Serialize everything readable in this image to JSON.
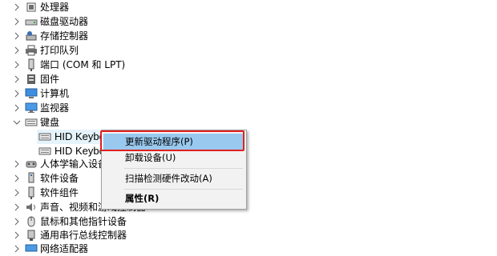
{
  "tree": {
    "items": [
      {
        "label": "处理器",
        "icon": "processor-icon"
      },
      {
        "label": "磁盘驱动器",
        "icon": "disk-drive-icon"
      },
      {
        "label": "存储控制器",
        "icon": "storage-controller-icon"
      },
      {
        "label": "打印队列",
        "icon": "printer-icon"
      },
      {
        "label": "端口 (COM 和 LPT)",
        "icon": "port-icon"
      },
      {
        "label": "固件",
        "icon": "firmware-icon"
      },
      {
        "label": "计算机",
        "icon": "computer-icon"
      },
      {
        "label": "监视器",
        "icon": "monitor-icon"
      },
      {
        "label": "键盘",
        "icon": "keyboard-icon",
        "expanded": true
      },
      {
        "label": "HID Keyboard Device",
        "icon": "keyboard-device-icon",
        "child": true
      },
      {
        "label": "HID Keyboard Device",
        "icon": "keyboard-device-icon",
        "child": true
      },
      {
        "label": "人体学输入设备",
        "icon": "hid-icon"
      },
      {
        "label": "软件设备",
        "icon": "software-device-icon"
      },
      {
        "label": "软件组件",
        "icon": "software-component-icon"
      },
      {
        "label": "声音、视频和游戏控制器",
        "icon": "sound-icon"
      },
      {
        "label": "鼠标和其他指针设备",
        "icon": "mouse-icon"
      },
      {
        "label": "通用串行总线控制器",
        "icon": "usb-icon"
      },
      {
        "label": "网络适配器",
        "icon": "network-adapter-icon"
      }
    ]
  },
  "context_menu": {
    "update_driver": "更新驱动程序(P)",
    "uninstall_device": "卸载设备(U)",
    "scan_hardware": "扫描检测硬件改动(A)",
    "properties": "属性(R)"
  },
  "colors": {
    "highlight": "#99c9ef",
    "annotation_box": "#e02020"
  }
}
